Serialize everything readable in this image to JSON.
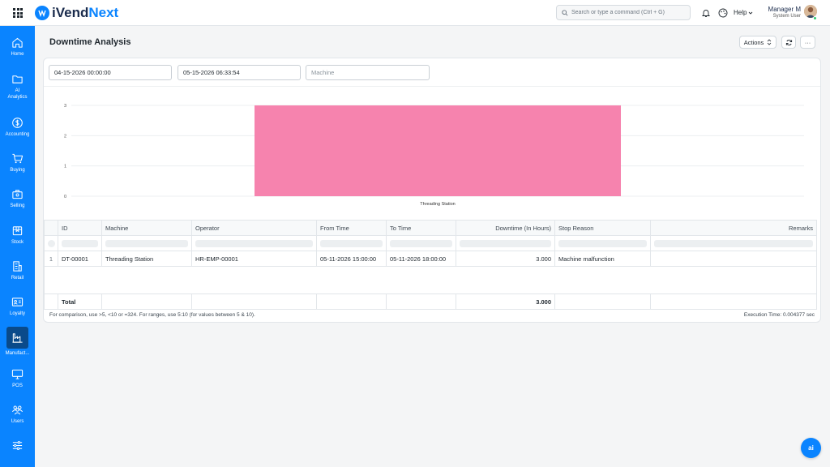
{
  "brand": {
    "name_prefix": "i",
    "name_main": "Vend",
    "name_suffix": "Next"
  },
  "search": {
    "placeholder": "Search or type a command (Ctrl + G)"
  },
  "header": {
    "help_label": "Help",
    "user_name": "Manager M",
    "user_role": "System User"
  },
  "sidebar": {
    "items": [
      {
        "label": "Home",
        "icon": "home-icon"
      },
      {
        "label": "AI\nAnalytics",
        "icon": "folder-icon"
      },
      {
        "label": "Accounting",
        "icon": "dollar-icon"
      },
      {
        "label": "Buying",
        "icon": "cart-icon"
      },
      {
        "label": "Selling",
        "icon": "briefcase-icon"
      },
      {
        "label": "Stock",
        "icon": "box-icon"
      },
      {
        "label": "Retail",
        "icon": "store-icon"
      },
      {
        "label": "Loyalty",
        "icon": "id-card-icon"
      },
      {
        "label": "Manufact...",
        "icon": "factory-icon",
        "active": true
      },
      {
        "label": "POS",
        "icon": "monitor-icon"
      },
      {
        "label": "Users",
        "icon": "users-icon"
      },
      {
        "label": "",
        "icon": "sliders-icon"
      }
    ]
  },
  "page": {
    "title": "Downtime Analysis",
    "actions_label": "Actions",
    "refresh_icon": "refresh-icon",
    "more_label": "···"
  },
  "filters": {
    "from_date": "04-15-2026 00:00:00",
    "to_date": "05-15-2026 06:33:54",
    "machine_placeholder": "Machine"
  },
  "chart_data": {
    "type": "bar",
    "categories": [
      "Threading Station"
    ],
    "values": [
      3
    ],
    "ylim": [
      0,
      3
    ],
    "yticks": [
      0,
      1,
      2,
      3
    ],
    "color": "#f683ae",
    "grid": true,
    "xlabel": "",
    "ylabel": ""
  },
  "table": {
    "columns": [
      "ID",
      "Machine",
      "Operator",
      "From Time",
      "To Time",
      "Downtime (In Hours)",
      "Stop Reason",
      "Remarks"
    ],
    "rows": [
      {
        "num": "1",
        "id": "DT-00001",
        "machine": "Threading Station",
        "operator": "HR-EMP-00001",
        "from_time": "05-11-2026 15:00:00",
        "to_time": "05-11-2026 18:00:00",
        "downtime": "3.000",
        "stop_reason": "Machine malfunction",
        "remarks": ""
      }
    ],
    "total_label": "Total",
    "total_downtime": "3.000"
  },
  "footer": {
    "note": "For comparison, use >5, <10 or =324. For ranges, use 5:10 (for values between 5 & 10).",
    "exec_time": "Execution Time: 0.004377 sec"
  },
  "ai_button_label": "ai"
}
